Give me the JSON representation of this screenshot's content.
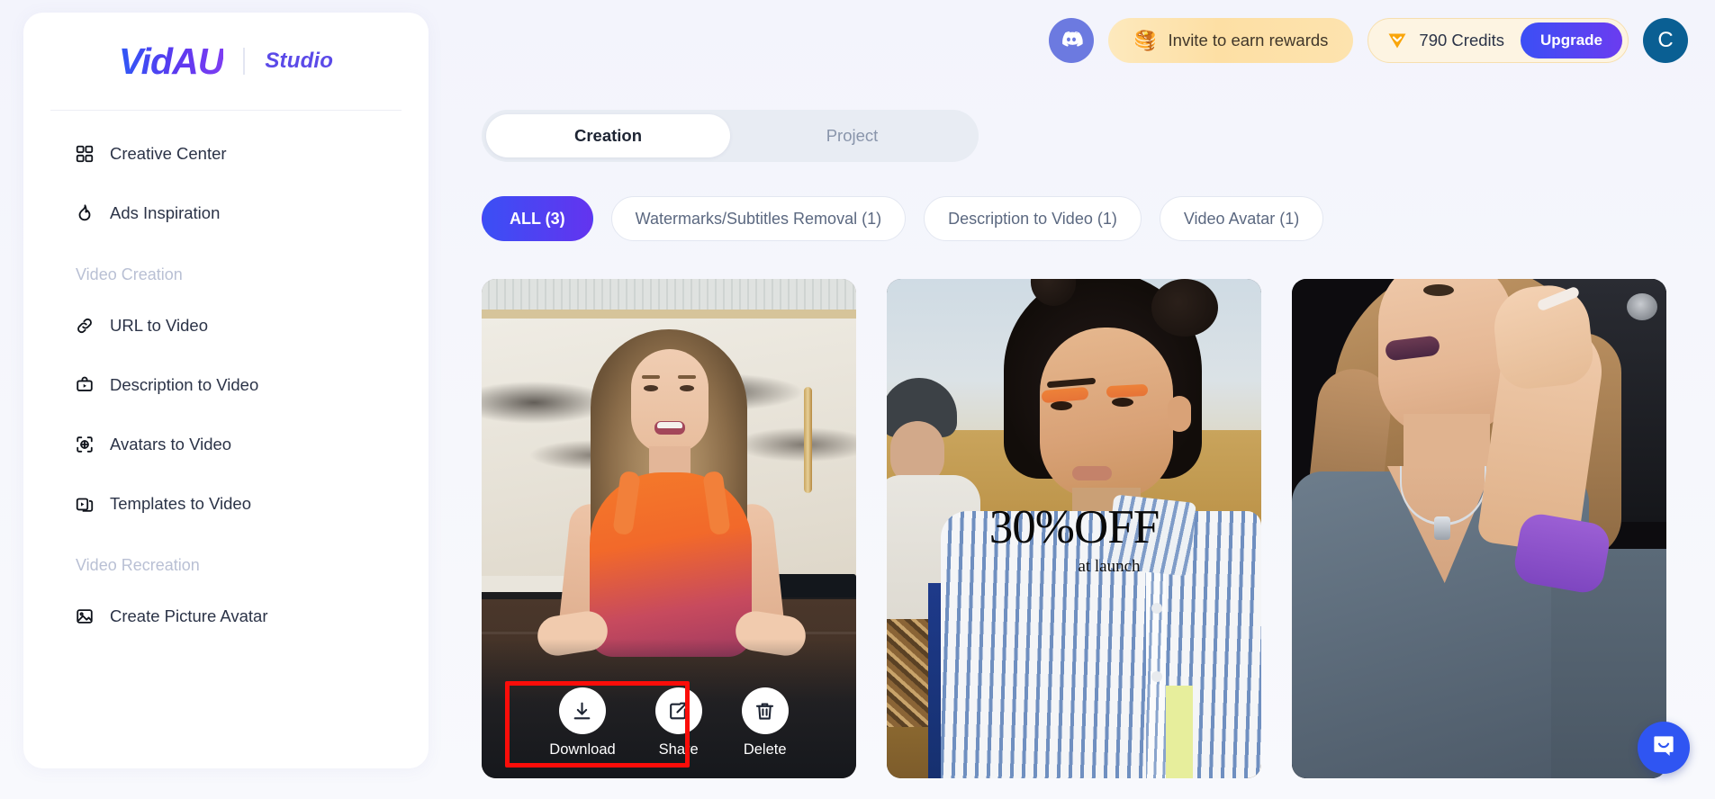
{
  "brand": {
    "logo": "VidAU",
    "studio": "Studio"
  },
  "sidebar": {
    "items": [
      {
        "label": "Creative Center",
        "icon": "grid-icon"
      },
      {
        "label": "Ads Inspiration",
        "icon": "flame-icon"
      }
    ],
    "sections": [
      {
        "title": "Video Creation",
        "items": [
          {
            "label": "URL to Video",
            "icon": "link-icon"
          },
          {
            "label": "Description to Video",
            "icon": "video-box-icon"
          },
          {
            "label": "Avatars to Video",
            "icon": "avatar-target-icon"
          },
          {
            "label": "Templates to Video",
            "icon": "templates-icon"
          }
        ]
      },
      {
        "title": "Video Recreation",
        "items": [
          {
            "label": "Create Picture Avatar",
            "icon": "image-icon"
          }
        ]
      }
    ]
  },
  "header": {
    "discord_icon": "discord-icon",
    "invite": {
      "emoji": "🥞",
      "label": "Invite to earn rewards"
    },
    "credits": {
      "icon": "gem-icon",
      "label": "790 Credits",
      "upgrade_label": "Upgrade"
    },
    "avatar_initial": "C"
  },
  "main": {
    "tabs": [
      {
        "label": "Creation",
        "active": true
      },
      {
        "label": "Project",
        "active": false
      }
    ],
    "filters": [
      {
        "label": "ALL (3)",
        "active": true
      },
      {
        "label": "Watermarks/Subtitles Removal (1)",
        "active": false
      },
      {
        "label": "Description to Video (1)",
        "active": false
      },
      {
        "label": "Video Avatar (1)",
        "active": false
      }
    ],
    "cards": [
      {
        "id": "card-1",
        "description": "Woman smiling in marble kitchen wearing orange and pink top",
        "actions": [
          {
            "label": "Download",
            "icon": "download-icon"
          },
          {
            "label": "Share",
            "icon": "share-icon"
          },
          {
            "label": "Delete",
            "icon": "trash-icon"
          }
        ]
      },
      {
        "id": "card-2",
        "description": "Woman in blue striped shirt in a golden field",
        "overlay_headline": "30%OFF",
        "overlay_subline": "at launch"
      },
      {
        "id": "card-3",
        "description": "Woman in gray shirt with purple sleeve raising hand to head"
      }
    ]
  },
  "chat": {
    "icon": "chat-bubble-icon"
  },
  "colors": {
    "accent_start": "#3b4ff5",
    "accent_end": "#6b3cf0",
    "page_background": "#f4f5fb",
    "invite_pill": "#fddfa4",
    "credits_pill": "#fdf4e2",
    "avatar": "#0a5f93",
    "annotation_red": "#fb0d09",
    "chat_blue": "#2f55f2"
  }
}
